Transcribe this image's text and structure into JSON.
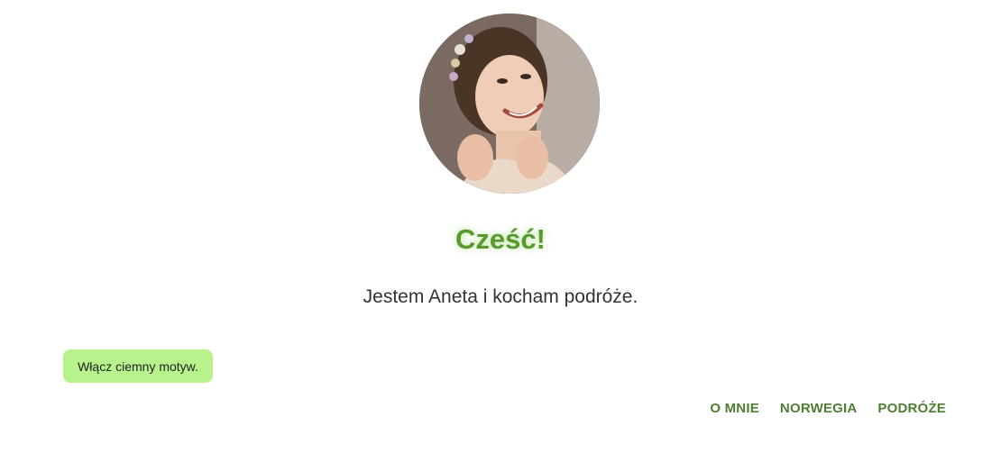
{
  "profile": {
    "avatar_icon": "portrait-photo"
  },
  "hero": {
    "greeting": "Cześć!",
    "intro": "Jestem Aneta i kocham podróże."
  },
  "theme_toggle": {
    "label": "Włącz ciemny motyw.",
    "background": "#b7f28c"
  },
  "nav": {
    "items": [
      {
        "label": "O MNIE"
      },
      {
        "label": "NORWEGIA"
      },
      {
        "label": "PODRÓŻE"
      }
    ],
    "color": "#4f7d33"
  },
  "colors": {
    "accent": "#5a9a2c"
  }
}
